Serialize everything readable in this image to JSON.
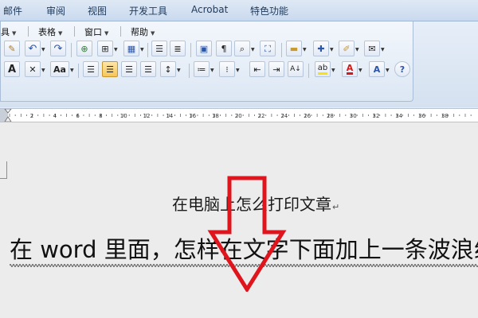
{
  "ribbon": {
    "tabs": [
      "邮件",
      "审阅",
      "视图",
      "开发工具",
      "Acrobat",
      "特色功能"
    ]
  },
  "menu": {
    "items": [
      "具",
      "表格",
      "窗口",
      "帮助"
    ]
  },
  "toolbar": {
    "font_scale_label": "Aa",
    "font_char_label": "A",
    "highlight_color": "#f7e014",
    "font_color": "#d21a1a"
  },
  "ruler": {
    "labels": [
      "2",
      "4",
      "6",
      "8",
      "10",
      "12",
      "14",
      "16",
      "18",
      "20",
      "22",
      "24",
      "26",
      "28",
      "30",
      "32",
      "34",
      "36",
      "38"
    ]
  },
  "document": {
    "heading": "在电脑上怎么打印文章",
    "paragraph_mark": "↵",
    "body": "在 word 里面，怎样在文字下面加上一条波浪线"
  },
  "annotation": {
    "arrow_color": "#e0141c"
  }
}
